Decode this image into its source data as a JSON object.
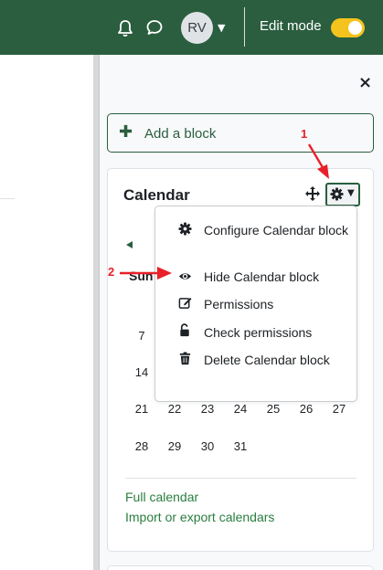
{
  "navbar": {
    "avatar_initials": "RV",
    "edit_mode_label": "Edit mode",
    "edit_mode_on": true,
    "brand_color": "#2a5e3f",
    "toggle_color": "#f4c31d"
  },
  "drawer": {
    "close_label": "×",
    "add_block_label": "Add a block"
  },
  "calendar": {
    "title": "Calendar",
    "weekday_first": "Sun",
    "days": [
      {
        "value": "7",
        "col": 0,
        "row": 0
      },
      {
        "value": "14",
        "col": 0,
        "row": 1
      },
      {
        "value": "21",
        "col": 0,
        "row": 2
      },
      {
        "value": "22",
        "col": 1,
        "row": 2
      },
      {
        "value": "23",
        "col": 2,
        "row": 2
      },
      {
        "value": "24",
        "col": 3,
        "row": 2
      },
      {
        "value": "25",
        "col": 4,
        "row": 2
      },
      {
        "value": "26",
        "col": 5,
        "row": 2
      },
      {
        "value": "27",
        "col": 6,
        "row": 2
      },
      {
        "value": "28",
        "col": 0,
        "row": 3
      },
      {
        "value": "29",
        "col": 1,
        "row": 3
      },
      {
        "value": "30",
        "col": 2,
        "row": 3
      },
      {
        "value": "31",
        "col": 3,
        "row": 3
      }
    ],
    "links": {
      "full": "Full calendar",
      "import_export": "Import or export calendars"
    }
  },
  "menu": {
    "items": [
      {
        "label": "Configure Calendar block",
        "icon": "gear-icon"
      },
      {
        "label": "Hide Calendar block",
        "icon": "eye-icon"
      },
      {
        "label": "Permissions",
        "icon": "edit-icon"
      },
      {
        "label": "Check permissions",
        "icon": "unlock-icon"
      },
      {
        "label": "Delete Calendar block",
        "icon": "trash-icon"
      }
    ]
  },
  "annotations": {
    "step1": "1",
    "step2": "2"
  }
}
